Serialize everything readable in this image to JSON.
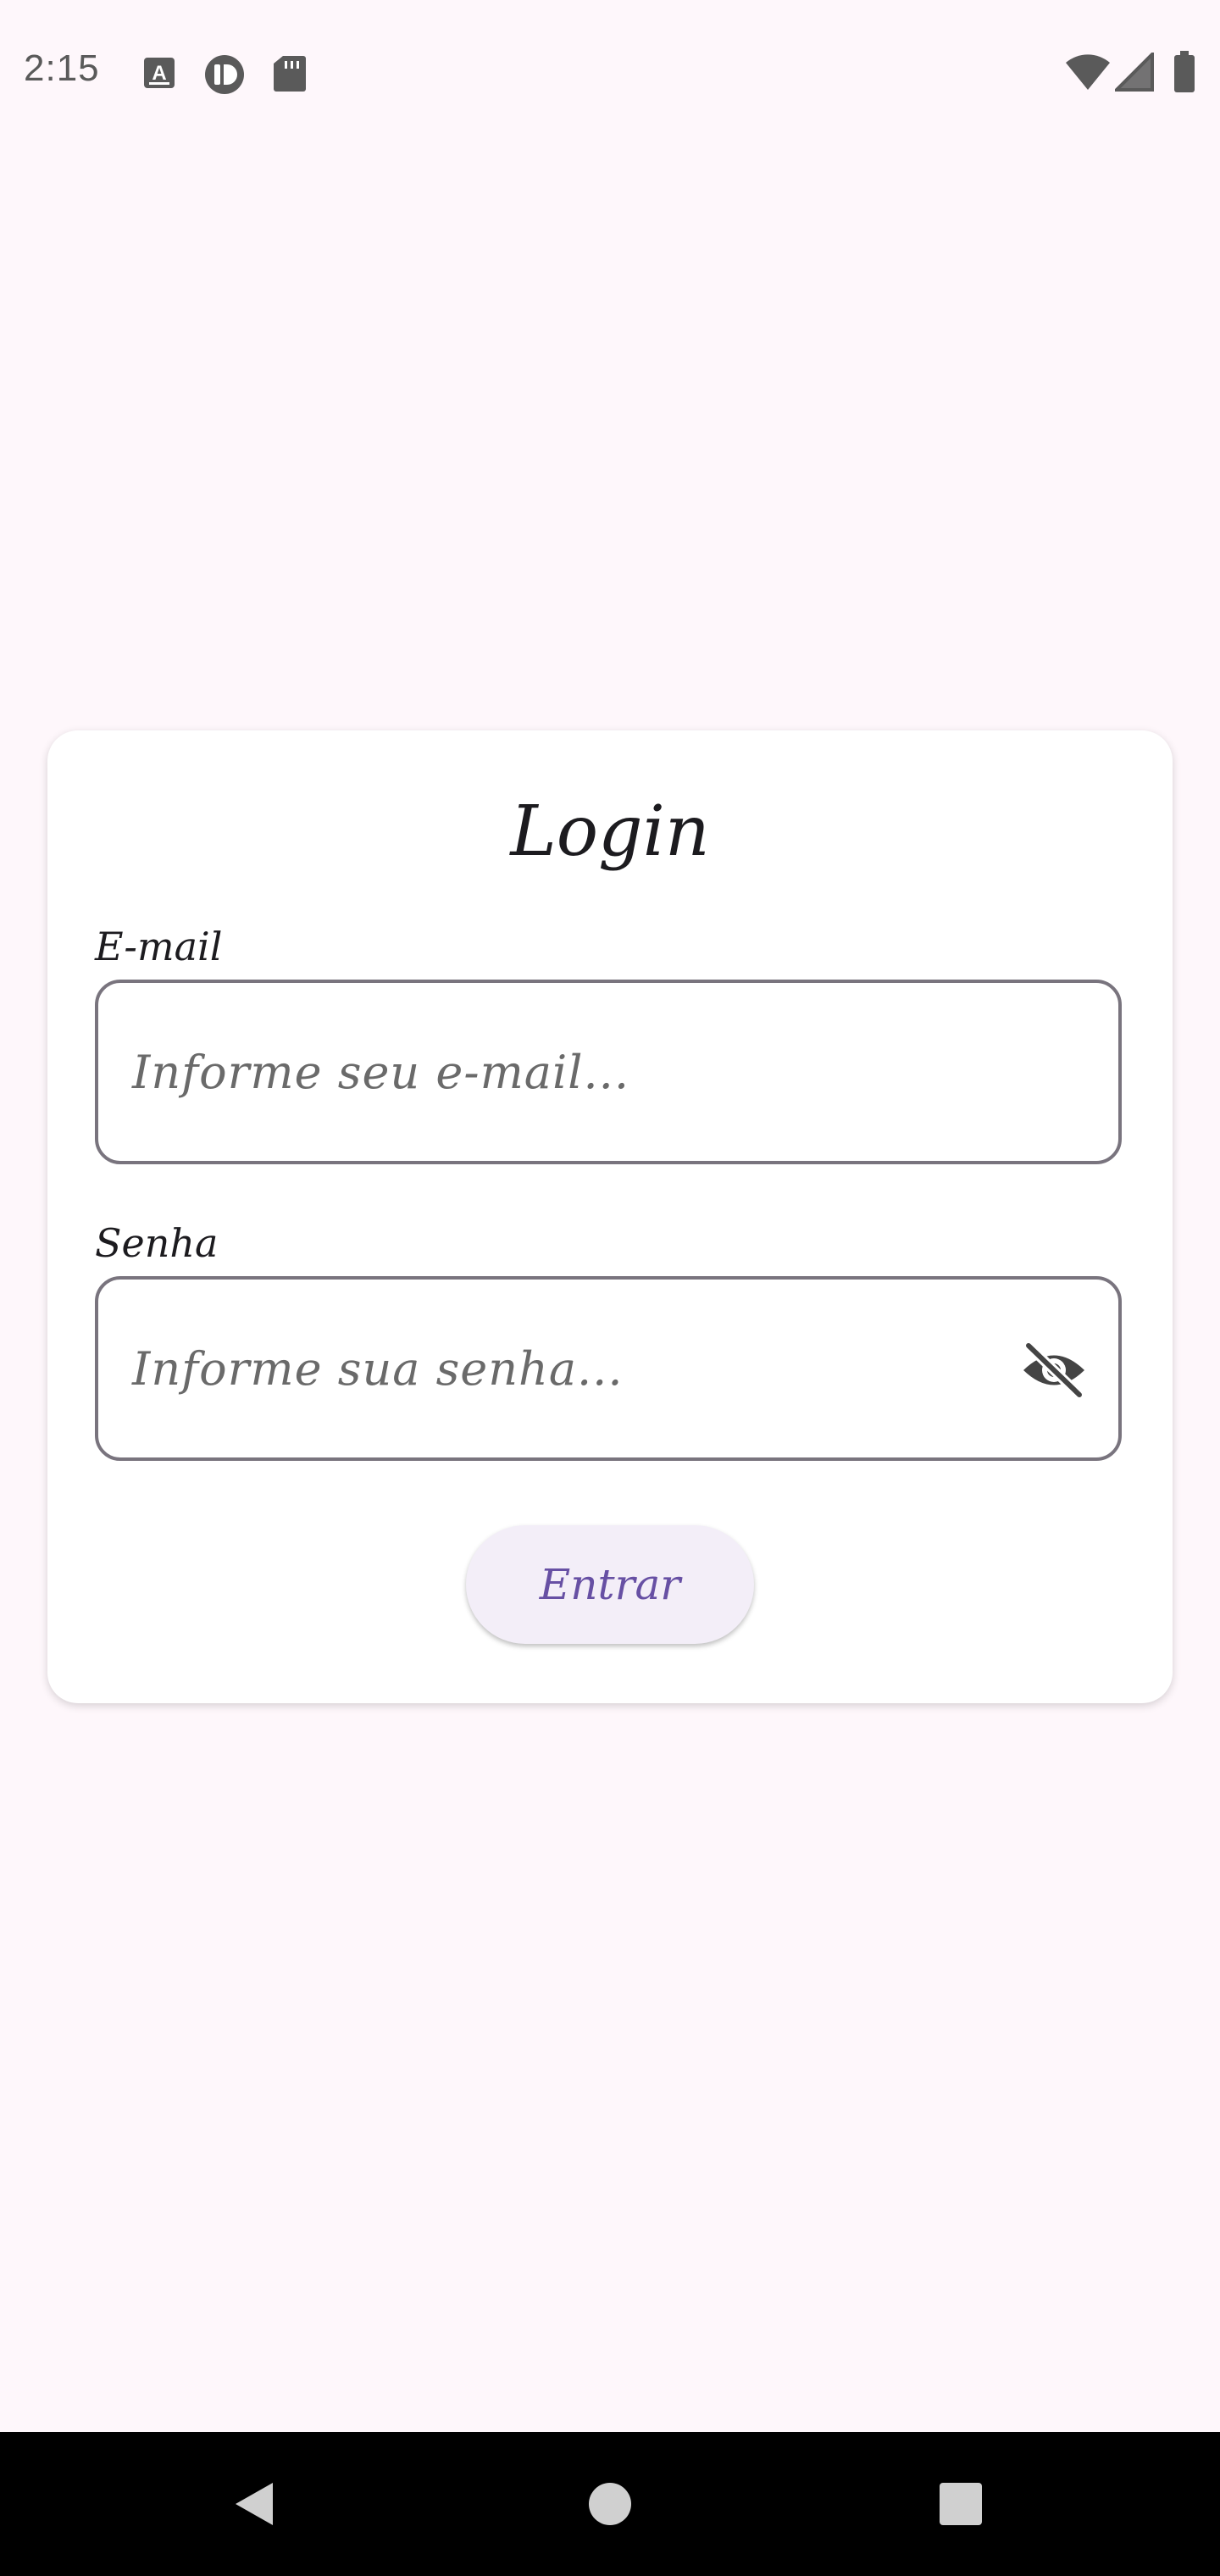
{
  "status_bar": {
    "time": "2:15",
    "icons": [
      "keyboard-a-icon",
      "record-icon",
      "sd-card-icon",
      "wifi-icon",
      "signal-icon",
      "battery-icon"
    ]
  },
  "login": {
    "title": "Login",
    "email_label": "E-mail",
    "email_placeholder": "Informe seu e-mail...",
    "password_label": "Senha",
    "password_placeholder": "Informe sua senha...",
    "submit_label": "Entrar"
  },
  "colors": {
    "background": "#fef7fb",
    "accent": "#6750a4",
    "button_bg": "#f3eef8",
    "outline": "#79747e"
  },
  "nav_bar": {
    "buttons": [
      "back-icon",
      "home-icon",
      "recents-icon"
    ]
  }
}
